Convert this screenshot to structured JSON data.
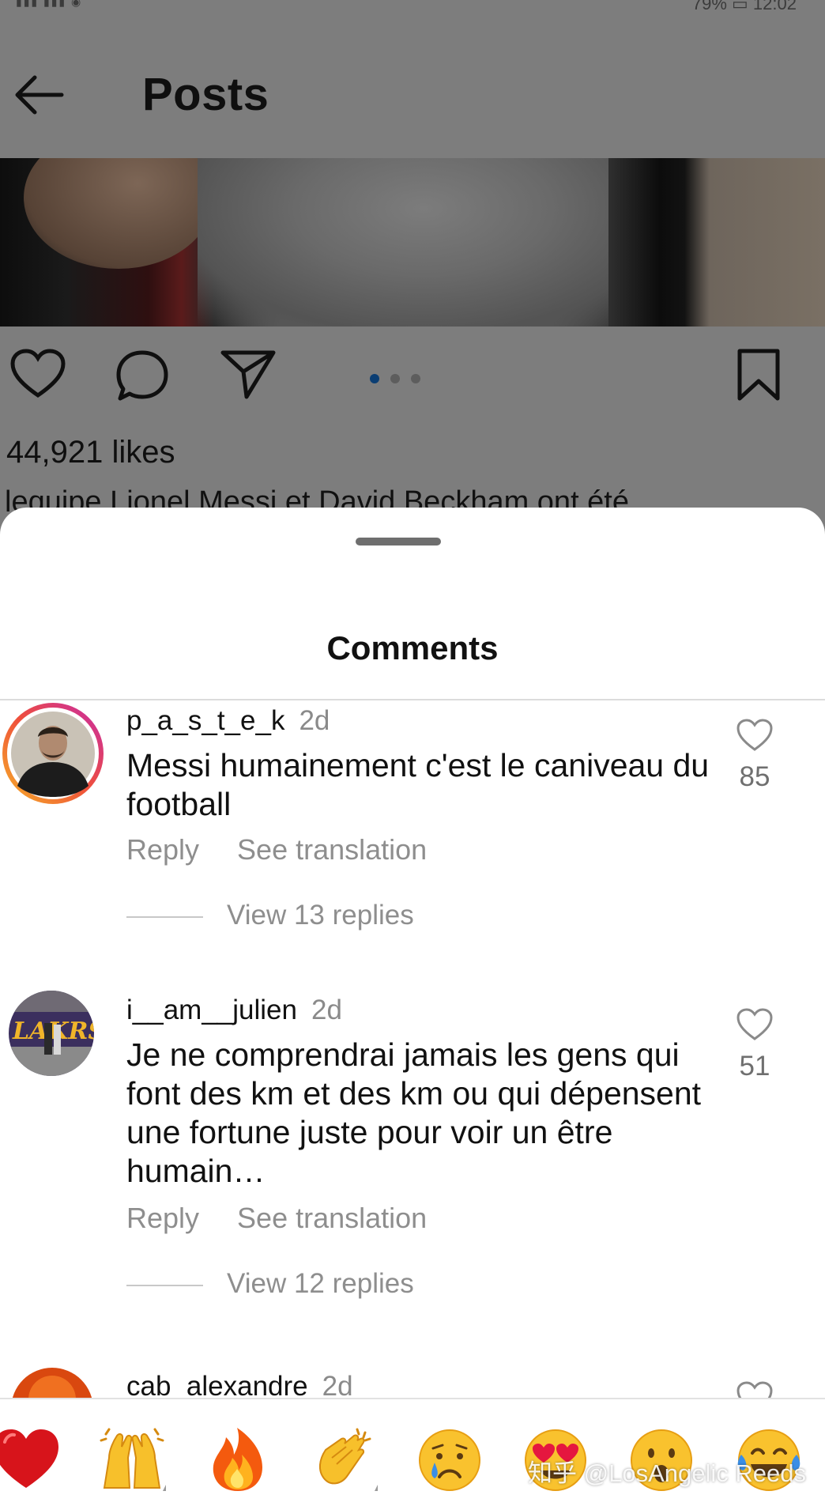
{
  "status_bar": {
    "right_text": "79% ▭ 12:02"
  },
  "header": {
    "title": "Posts"
  },
  "post": {
    "likes": "44,921 likes",
    "caption": "lequipe Lionel Messi et David Beckham ont été",
    "carousel": {
      "count": 3,
      "active": 1
    }
  },
  "sheet": {
    "title": "Comments",
    "comments": [
      {
        "username": "p_a_s_t_e_k",
        "time": "2d",
        "text": "Messi humainement c'est le caniveau du football",
        "reply": "Reply",
        "see_translation": "See translation",
        "view_replies": "View 13 replies",
        "likes": "85"
      },
      {
        "username": "i__am__julien",
        "time": "2d",
        "text": "Je ne comprendrai jamais les gens qui font des km et des km ou qui dépensent une fortune juste pour voir un être humain…",
        "reply": "Reply",
        "see_translation": "See translation",
        "view_replies": "View 12 replies",
        "likes": "51"
      },
      {
        "username": "cab_alexandre",
        "time": "2d"
      }
    ]
  },
  "emoji_bar": {
    "items": [
      "red-heart",
      "raising-hands",
      "fire",
      "clapping-hands",
      "crying-face",
      "heart-eyes-face",
      "surprised-face",
      "tears-of-joy-face"
    ]
  },
  "watermark": "知乎 @LosAngelic Reeds",
  "colors": {
    "accent_dot": "#0b3e73",
    "story_ring_start": "#f6b227",
    "story_ring_end": "#c72aa9"
  }
}
